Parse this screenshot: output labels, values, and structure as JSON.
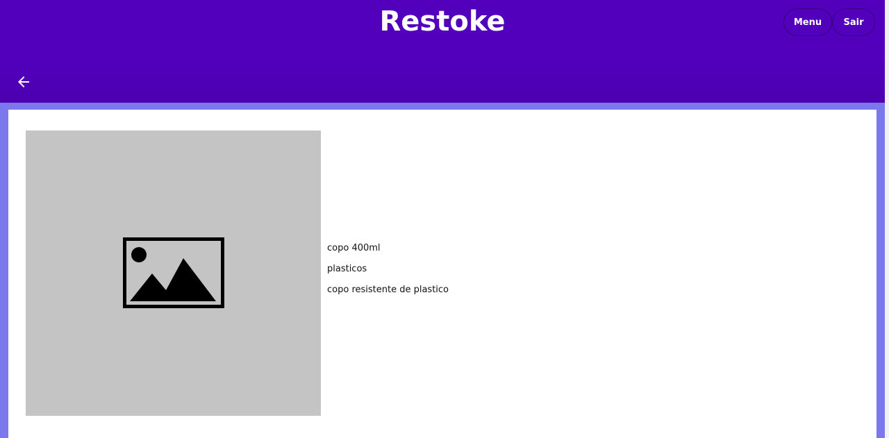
{
  "app": {
    "title": "Restoke"
  },
  "header": {
    "menu_label": "Menu",
    "logout_label": "Sair",
    "back_icon": "arrow-left-icon"
  },
  "product": {
    "image_icon": "image-placeholder-icon",
    "name": "copo 400ml",
    "category": "plasticos",
    "description": "copo resistente de plastico"
  },
  "colors": {
    "header": "#5200bc",
    "background": "#7b78ee",
    "card": "#ffffff",
    "image_placeholder": "#c4c4c4"
  }
}
